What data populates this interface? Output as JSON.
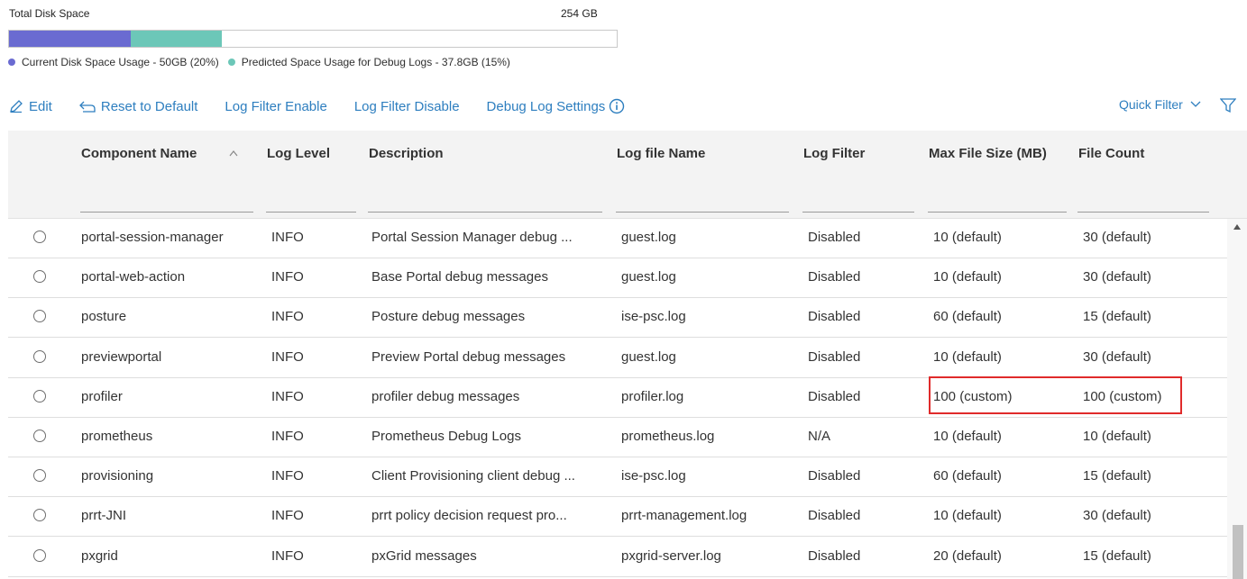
{
  "disk": {
    "title": "Total Disk Space",
    "total": "254 GB",
    "current_fraction": 0.2,
    "predicted_fraction": 0.15,
    "legend": [
      {
        "label": "Current Disk Space Usage - 50GB (20%)",
        "color": "#6a6bd1"
      },
      {
        "label": "Predicted Space Usage for Debug Logs - 37.8GB (15%)",
        "color": "#6cc7b8"
      }
    ]
  },
  "toolbar": {
    "edit": "Edit",
    "reset": "Reset to Default",
    "filter_enable": "Log Filter Enable",
    "filter_disable": "Log Filter Disable",
    "debug_settings": "Debug Log Settings",
    "quick_filter": "Quick Filter"
  },
  "table": {
    "columns": [
      "Component Name",
      "Log Level",
      "Description",
      "Log file Name",
      "Log Filter",
      "Max File Size (MB)",
      "File Count"
    ],
    "rows": [
      [
        "portal-session-manager",
        "INFO",
        "Portal Session Manager debug ...",
        "guest.log",
        "Disabled",
        "10 (default)",
        "30 (default)"
      ],
      [
        "portal-web-action",
        "INFO",
        "Base Portal debug messages",
        "guest.log",
        "Disabled",
        "10 (default)",
        "30 (default)"
      ],
      [
        "posture",
        "INFO",
        "Posture debug messages",
        "ise-psc.log",
        "Disabled",
        "60 (default)",
        "15 (default)"
      ],
      [
        "previewportal",
        "INFO",
        "Preview Portal debug messages",
        "guest.log",
        "Disabled",
        "10 (default)",
        "30 (default)"
      ],
      [
        "profiler",
        "INFO",
        "profiler debug messages",
        "profiler.log",
        "Disabled",
        "100 (custom)",
        "100 (custom)"
      ],
      [
        "prometheus",
        "INFO",
        "Prometheus Debug Logs",
        "prometheus.log",
        "N/A",
        "10 (default)",
        "10 (default)"
      ],
      [
        "provisioning",
        "INFO",
        "Client Provisioning client debug ...",
        "ise-psc.log",
        "Disabled",
        "60 (default)",
        "15 (default)"
      ],
      [
        "prrt-JNI",
        "INFO",
        "prrt policy decision request pro...",
        "prrt-management.log",
        "Disabled",
        "10 (default)",
        "30 (default)"
      ],
      [
        "pxgrid",
        "INFO",
        "pxGrid messages",
        "pxgrid-server.log",
        "Disabled",
        "20 (default)",
        "15 (default)"
      ]
    ]
  },
  "colors": {
    "accent": "#2d7ebf",
    "highlight": "#e02b2b"
  }
}
